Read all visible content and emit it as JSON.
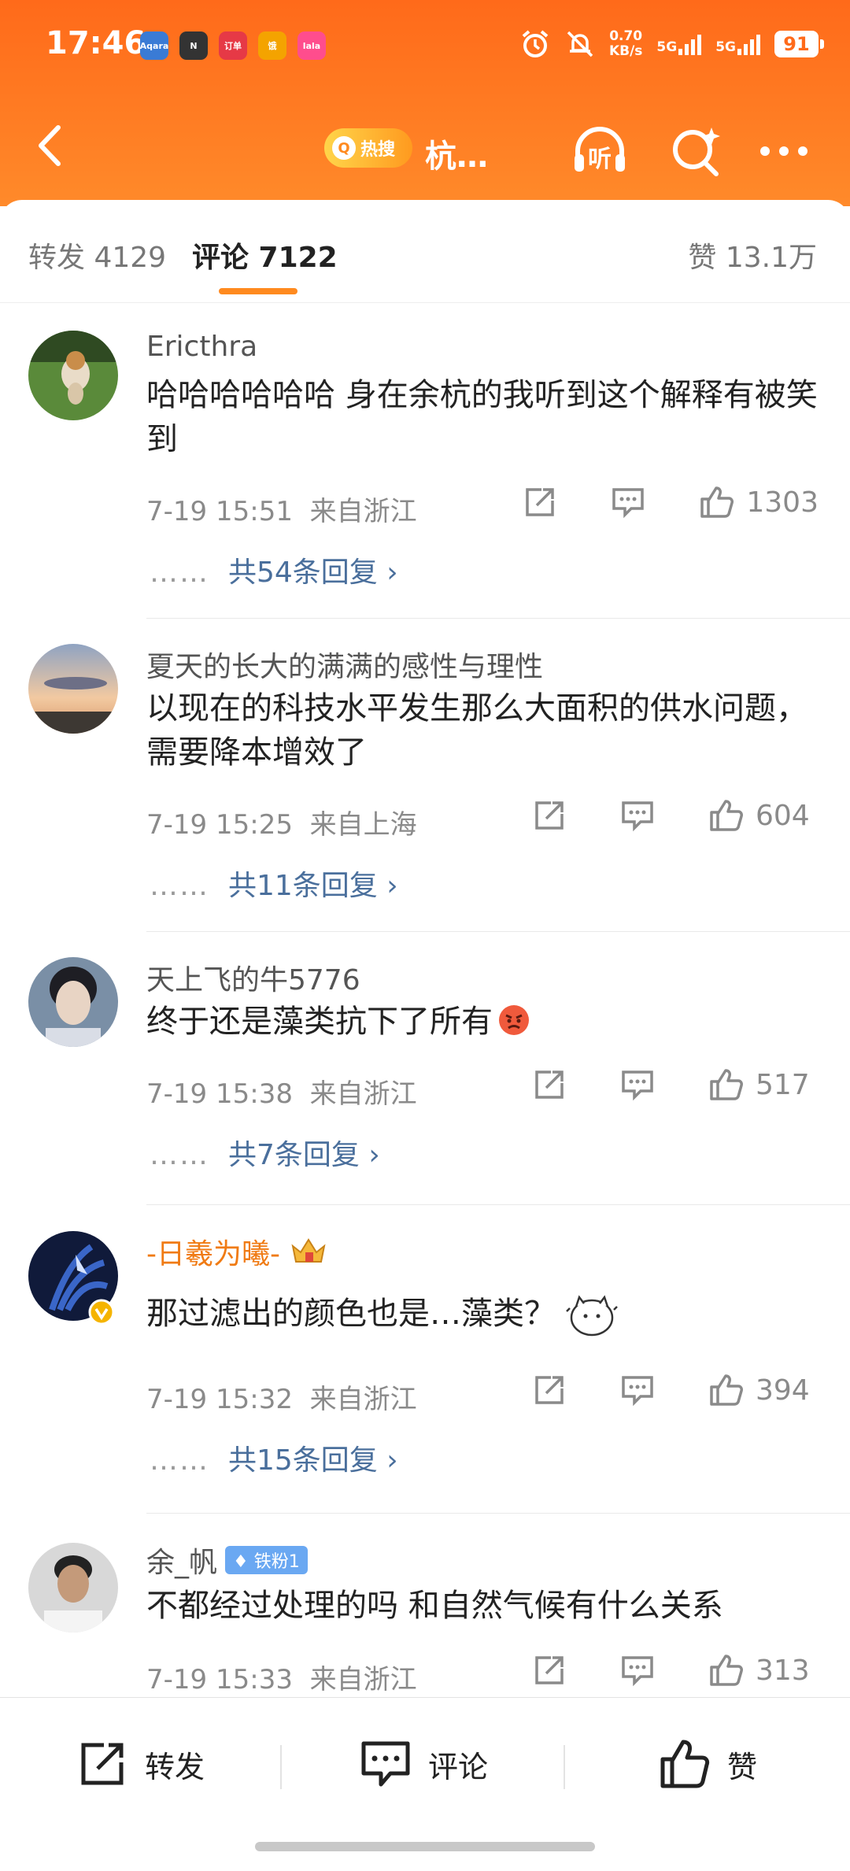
{
  "status_bar": {
    "time": "17:46",
    "app_icons": [
      "Aqara",
      "N",
      "订单",
      "饿",
      "lala"
    ],
    "net_speed": "0.70",
    "net_unit": "KB/s",
    "sim1": "5G",
    "sim2": "5G",
    "battery": "91"
  },
  "nav": {
    "hot_badge": "热搜",
    "title": "杭…",
    "listen_label": "听"
  },
  "tabs": {
    "repost": "转发 4129",
    "comments": "评论 7122",
    "likes": "赞 13.1万"
  },
  "comments": [
    {
      "user": "Ericthra",
      "text": "哈哈哈哈哈哈 身在余杭的我听到这个解释有被笑到",
      "time": "7-19 15:51",
      "location": "来自浙江",
      "likes": "1303",
      "replies": "共54条回复 ›"
    },
    {
      "user": "夏天的长大的满满的感性与理性",
      "text": "以现在的科技水平发生那么大面积的供水问题，需要降本增效了",
      "time": "7-19 15:25",
      "location": "来自上海",
      "likes": "604",
      "replies": "共11条回复 ›"
    },
    {
      "user": "天上飞的牛5776",
      "text": "终于还是藻类抗下了所有",
      "time": "7-19 15:38",
      "location": "来自浙江",
      "likes": "517",
      "replies": "共7条回复 ›"
    },
    {
      "user": "-日羲为曦-",
      "text": "那过滤出的颜色也是…藻类？",
      "time": "7-19 15:32",
      "location": "来自浙江",
      "likes": "394",
      "replies": "共15条回复 ›"
    },
    {
      "user": "余_帆",
      "badge": "铁粉1",
      "text": "不都经过处理的吗 和自然气候有什么关系",
      "time": "7-19 15:33",
      "location": "来自浙江",
      "likes": "313"
    }
  ],
  "bottom_bar": {
    "repost": "转发",
    "comment": "评论",
    "like": "赞"
  },
  "colors": {
    "header_orange": "#ff6a1a",
    "reply_link": "#4a6f9c",
    "username_vip": "#f07b14"
  }
}
